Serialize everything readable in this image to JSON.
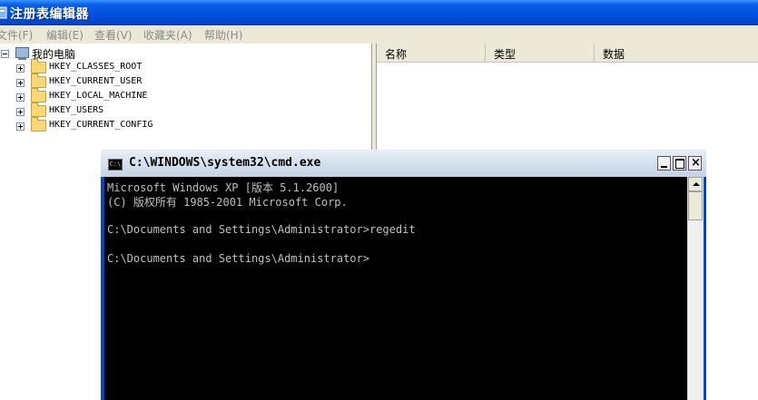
{
  "regedit": {
    "title": "注册表编辑器",
    "menu": [
      {
        "label": "文件(F)"
      },
      {
        "label": "编辑(E)"
      },
      {
        "label": "查看(V)"
      },
      {
        "label": "收藏夹(A)"
      },
      {
        "label": "帮助(H)"
      }
    ],
    "tree": {
      "root_label": "我的电脑",
      "nodes": [
        {
          "label": "HKEY_CLASSES_ROOT"
        },
        {
          "label": "HKEY_CURRENT_USER"
        },
        {
          "label": "HKEY_LOCAL_MACHINE"
        },
        {
          "label": "HKEY_USERS"
        },
        {
          "label": "HKEY_CURRENT_CONFIG"
        }
      ]
    },
    "list_columns": [
      "名称",
      "类型",
      "数据"
    ]
  },
  "cmd": {
    "title": "C:\\WINDOWS\\system32\\cmd.exe",
    "icon_text": "C:\\",
    "lines": [
      "Microsoft Windows XP [版本 5.1.2600]",
      "(C) 版权所有 1985-2001 Microsoft Corp.",
      "",
      "C:\\Documents and Settings\\Administrator>regedit",
      "",
      "C:\\Documents and Settings\\Administrator>"
    ],
    "close_glyph": "×"
  },
  "colors": {
    "xp_blue": "#0054e3",
    "console_bg": "#000000",
    "console_fg": "#c0c0c0",
    "folder": "#f8d775"
  }
}
